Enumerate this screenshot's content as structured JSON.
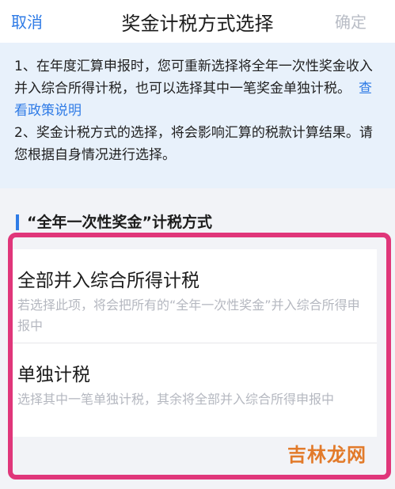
{
  "header": {
    "cancel": "取消",
    "title": "奖金计税方式选择",
    "confirm": "确定"
  },
  "notice": {
    "line1": "1、在年度汇算申报时，您可重新选择将全年一次性奖金收入并入综合所得计税，也可以选择其中一笔奖金单独计税。",
    "policy_link": "查看政策说明",
    "line2": "2、奖金计税方式的选择，将会影响汇算的税款计算结果。请您根据自身情况进行选择。"
  },
  "section": {
    "title": "“全年一次性奖金”计税方式"
  },
  "options": [
    {
      "title": "全部并入综合所得计税",
      "desc": "若选择此项，将会把所有的“全年一次性奖金”并入综合所得申报中"
    },
    {
      "title": "单独计税",
      "desc": "选择其中一笔单独计税，其余将全部并入综合所得申报中"
    }
  ],
  "watermark": "吉林龙网",
  "colors": {
    "accent": "#2f7be6",
    "highlight_border": "#e0367a",
    "notice_bg": "#e8f1fb"
  }
}
